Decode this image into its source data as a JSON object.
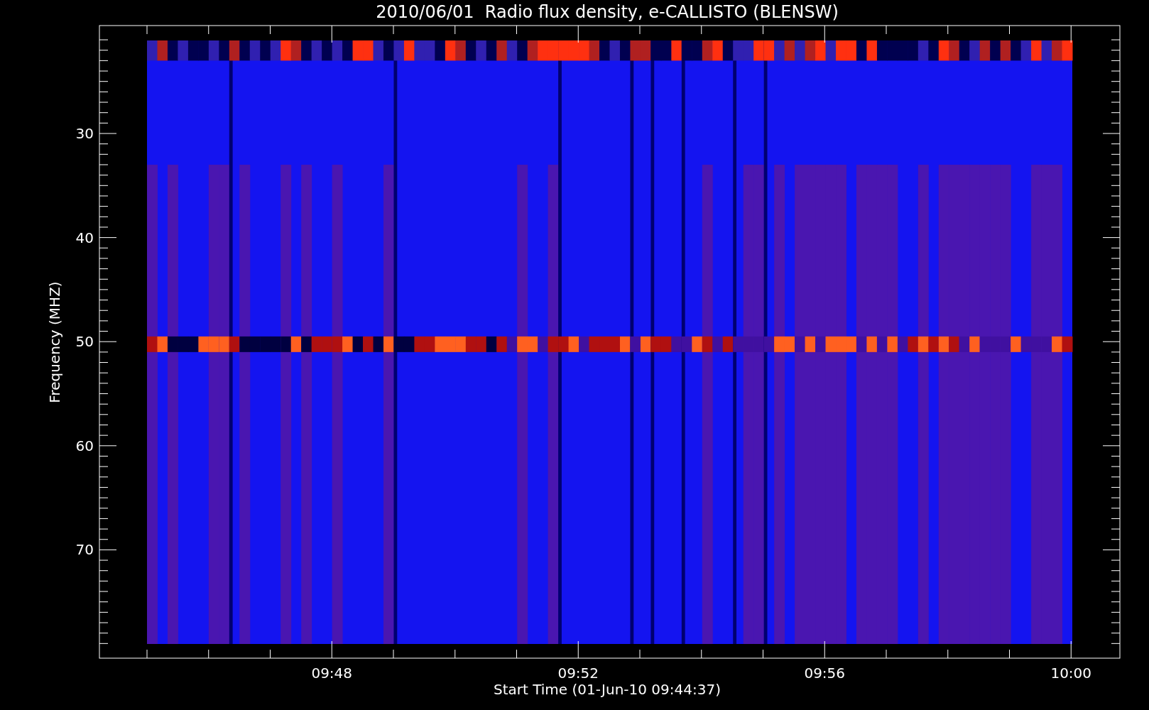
{
  "title": "2010/06/01  Radio flux density, e-CALLISTO (BLENSW)",
  "y_axis": {
    "label": "Frequency (MHZ)",
    "ticks": [
      "30",
      "40",
      "50",
      "60",
      "70"
    ]
  },
  "x_axis": {
    "label": "Start Time (01-Jun-10 09:44:37)",
    "ticks": [
      "09:48",
      "09:52",
      "09:56",
      "10:00"
    ]
  }
}
